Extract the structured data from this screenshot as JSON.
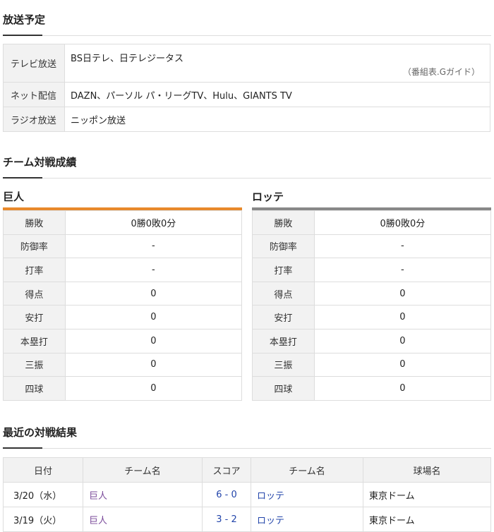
{
  "broadcast": {
    "title": "放送予定",
    "rows": [
      {
        "label": "テレビ放送",
        "value": "BS日テレ、日テレジータス",
        "note": "（番組表.Gガイド）"
      },
      {
        "label": "ネット配信",
        "value": "DAZN、パーソル パ・リーグTV、Hulu、GIANTS TV"
      },
      {
        "label": "ラジオ放送",
        "value": "ニッポン放送"
      }
    ]
  },
  "team_stats": {
    "title": "チーム対戦成績",
    "accent_left": "#e8892b",
    "accent_right": "#888888",
    "labels": [
      "勝敗",
      "防御率",
      "打率",
      "得点",
      "安打",
      "本塁打",
      "三振",
      "四球"
    ],
    "teams": [
      {
        "name": "巨人",
        "values": [
          "0勝0敗0分",
          "-",
          "-",
          "0",
          "0",
          "0",
          "0",
          "0"
        ]
      },
      {
        "name": "ロッテ",
        "values": [
          "0勝0敗0分",
          "-",
          "-",
          "0",
          "0",
          "0",
          "0",
          "0"
        ]
      }
    ]
  },
  "results": {
    "title": "最近の対戦結果",
    "headers": [
      "日付",
      "チーム名",
      "スコア",
      "チーム名",
      "球場名"
    ],
    "rows": [
      {
        "date": "3/20（水）",
        "team1": "巨人",
        "score": "6 - 0",
        "team2": "ロッテ",
        "venue": "東京ドーム"
      },
      {
        "date": "3/19（火）",
        "team1": "巨人",
        "score": "3 - 2",
        "team2": "ロッテ",
        "venue": "東京ドーム"
      }
    ]
  }
}
